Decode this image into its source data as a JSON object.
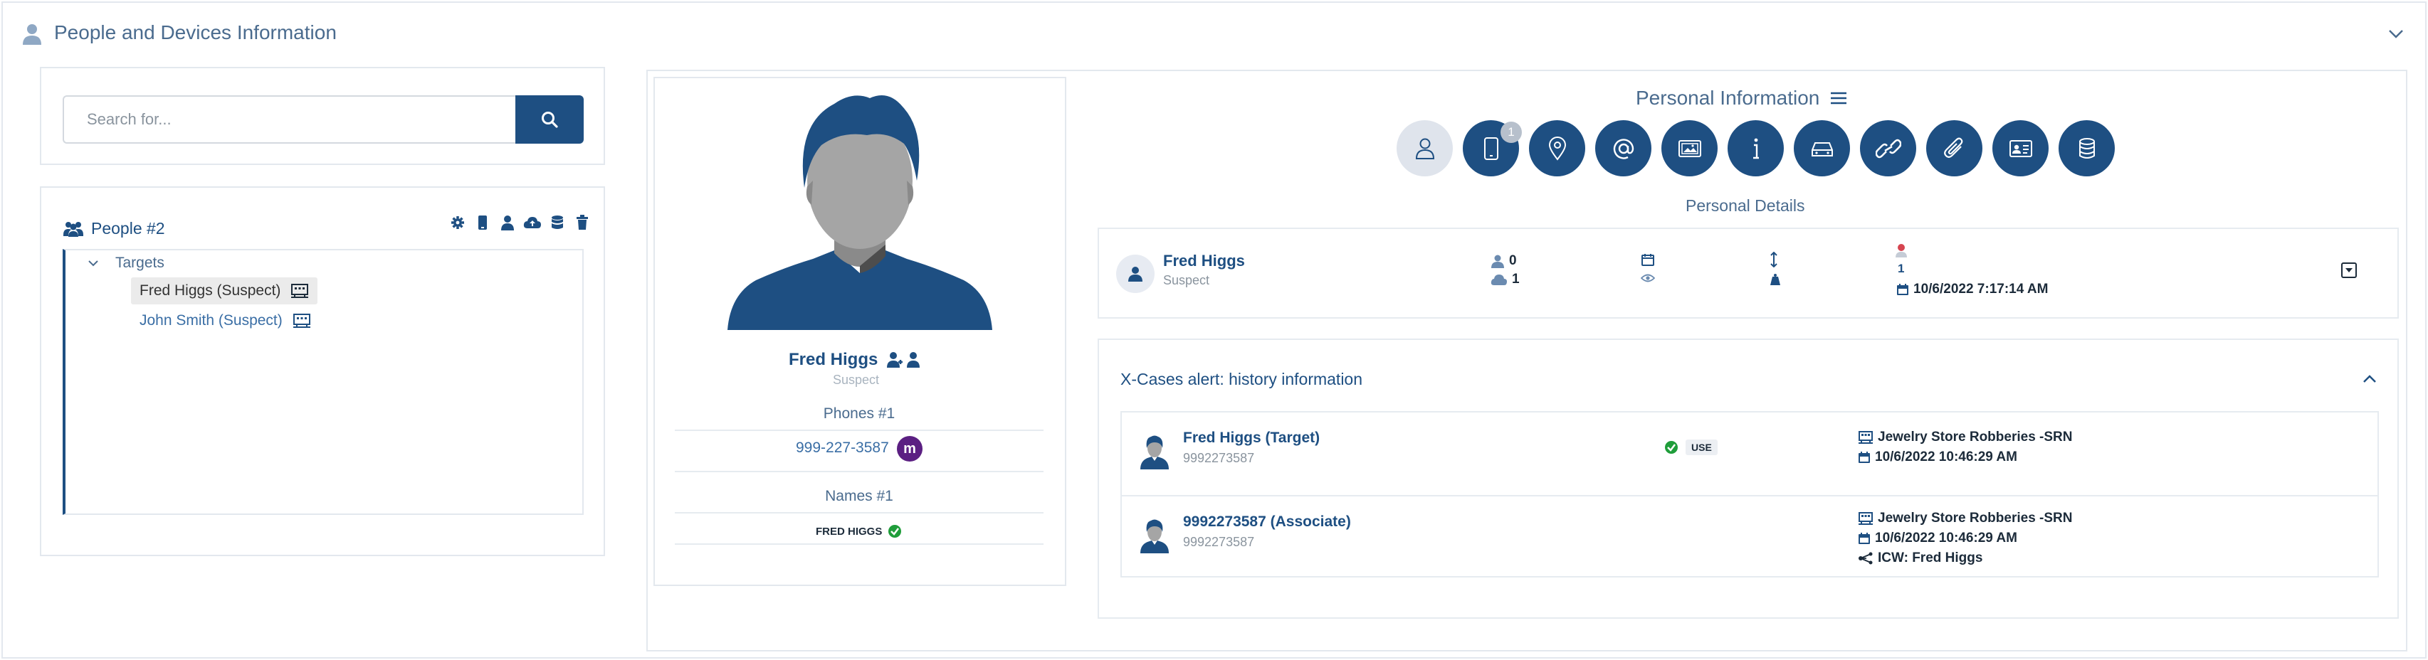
{
  "header": {
    "title": "People and Devices Information"
  },
  "search": {
    "placeholder": "Search for..."
  },
  "people": {
    "title": "People #2",
    "tree_group": "Targets",
    "items": [
      {
        "label": "Fred Higgs (Suspect)"
      },
      {
        "label": "John Smith (Suspect)"
      }
    ]
  },
  "profile": {
    "name": "Fred Higgs",
    "role": "Suspect",
    "phones_label": "Phones #1",
    "phone": "999-227-3587",
    "phone_badge": "m",
    "names_label": "Names #1",
    "name_value": "FRED HIGGS"
  },
  "personal_info": {
    "title": "Personal Information",
    "device_badge": "1",
    "icons": [
      "person-icon",
      "phone-icon",
      "location-icon",
      "at-icon",
      "image-icon",
      "info-icon",
      "car-icon",
      "link-icon",
      "paperclip-icon",
      "id-card-icon",
      "database-icon"
    ],
    "details_title": "Personal Details",
    "details": {
      "name": "Fred Higgs",
      "role": "Suspect",
      "count_a": "0",
      "count_b": "1",
      "count_c": "1",
      "date": "10/6/2022 7:17:14 AM"
    }
  },
  "xcases": {
    "title": "X-Cases alert: history information",
    "rows": [
      {
        "name": "Fred Higgs (Target)",
        "sub": "9992273587",
        "use": "USE",
        "case": "Jewelry Store Robberies -SRN",
        "date": "10/6/2022 10:46:29 AM"
      },
      {
        "name": "9992273587 (Associate)",
        "sub": "9992273587",
        "case": "Jewelry Store Robberies -SRN",
        "date": "10/6/2022 10:46:29 AM",
        "icw": "ICW: Fred Higgs"
      }
    ]
  },
  "colors": {
    "primary": "#1e4f82",
    "accent": "#5b1f82",
    "success": "#1f9d3a"
  }
}
